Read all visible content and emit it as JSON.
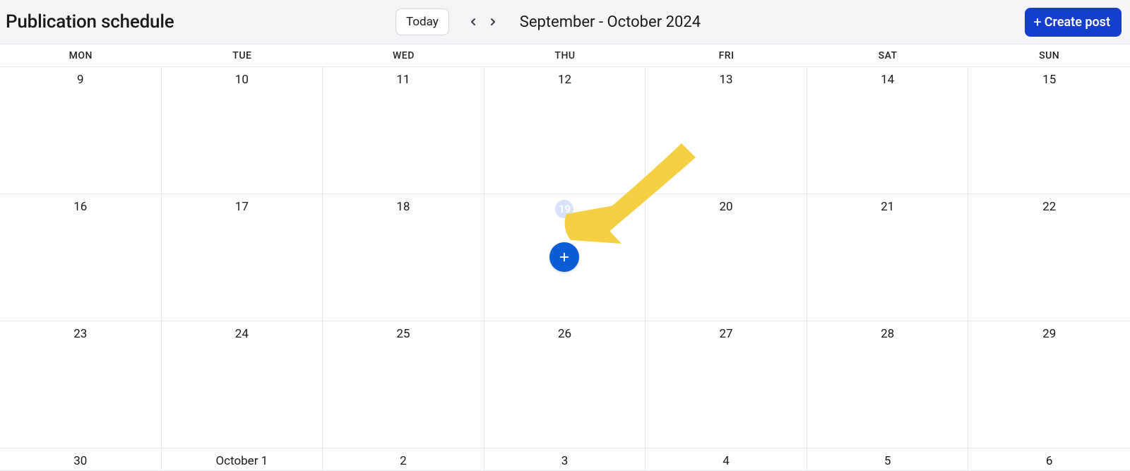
{
  "header": {
    "title": "Publication schedule",
    "today_label": "Today",
    "date_range": "September - October 2024",
    "create_post_label": "Create post"
  },
  "weekdays": [
    "MON",
    "TUE",
    "WED",
    "THU",
    "FRI",
    "SAT",
    "SUN"
  ],
  "weeks": [
    [
      {
        "label": "9"
      },
      {
        "label": "10"
      },
      {
        "label": "11"
      },
      {
        "label": "12"
      },
      {
        "label": "13"
      },
      {
        "label": "14"
      },
      {
        "label": "15"
      }
    ],
    [
      {
        "label": "16"
      },
      {
        "label": "17"
      },
      {
        "label": "18"
      },
      {
        "label": "19",
        "highlight": true,
        "has_add_button": true
      },
      {
        "label": "20"
      },
      {
        "label": "21"
      },
      {
        "label": "22"
      }
    ],
    [
      {
        "label": "23"
      },
      {
        "label": "24"
      },
      {
        "label": "25"
      },
      {
        "label": "26"
      },
      {
        "label": "27"
      },
      {
        "label": "28"
      },
      {
        "label": "29"
      }
    ],
    [
      {
        "label": "30"
      },
      {
        "label": "October 1"
      },
      {
        "label": "2"
      },
      {
        "label": "3"
      },
      {
        "label": "4"
      },
      {
        "label": "5"
      },
      {
        "label": "6"
      }
    ]
  ],
  "colors": {
    "primary_button": "#143fcd",
    "add_circle": "#0a5dd6",
    "highlight_bg": "#d7e3fb",
    "annotation_arrow": "#f6d043"
  }
}
